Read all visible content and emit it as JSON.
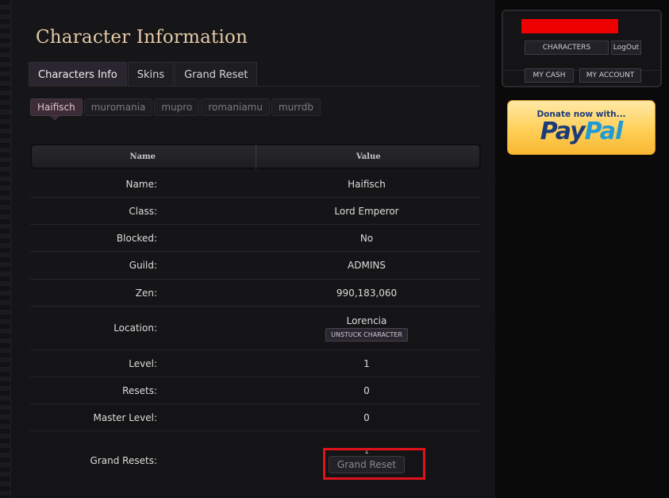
{
  "page": {
    "title": "Character Information"
  },
  "tabs": [
    {
      "label": "Characters Info"
    },
    {
      "label": "Skins"
    },
    {
      "label": "Grand Reset"
    }
  ],
  "characters": [
    {
      "label": "Haifisch"
    },
    {
      "label": "muromania"
    },
    {
      "label": "mupro"
    },
    {
      "label": "romaniamu"
    },
    {
      "label": "murrdb"
    }
  ],
  "table": {
    "headers": {
      "name": "Name",
      "value": "Value"
    },
    "rows": [
      {
        "label": "Name:",
        "value": "Haifisch"
      },
      {
        "label": "Class:",
        "value": "Lord Emperor"
      },
      {
        "label": "Blocked:",
        "value": "No"
      },
      {
        "label": "Guild:",
        "value": "ADMINS"
      },
      {
        "label": "Zen:",
        "value": "990,183,060"
      },
      {
        "label": "Location:",
        "value": "Lorencia",
        "button": "UNSTUCK CHARACTER"
      },
      {
        "label": "Level:",
        "value": "1"
      },
      {
        "label": "Resets:",
        "value": "0"
      },
      {
        "label": "Master Level:",
        "value": "0"
      },
      {
        "label": "Grand Resets:",
        "value": "1",
        "button": "Grand Reset"
      }
    ]
  },
  "account_panel": {
    "characters_button": "CHARACTERS",
    "logout_button": "LogOut",
    "my_cash_button": "MY CASH",
    "my_account_button": "MY ACCOUNT"
  },
  "paypal": {
    "tagline": "Donate now with...",
    "logo_part1": "Pay",
    "logo_part2": "Pal"
  },
  "colors": {
    "highlight": "#e0121a",
    "redaction": "#ee0000",
    "title": "#e3c9a8"
  }
}
